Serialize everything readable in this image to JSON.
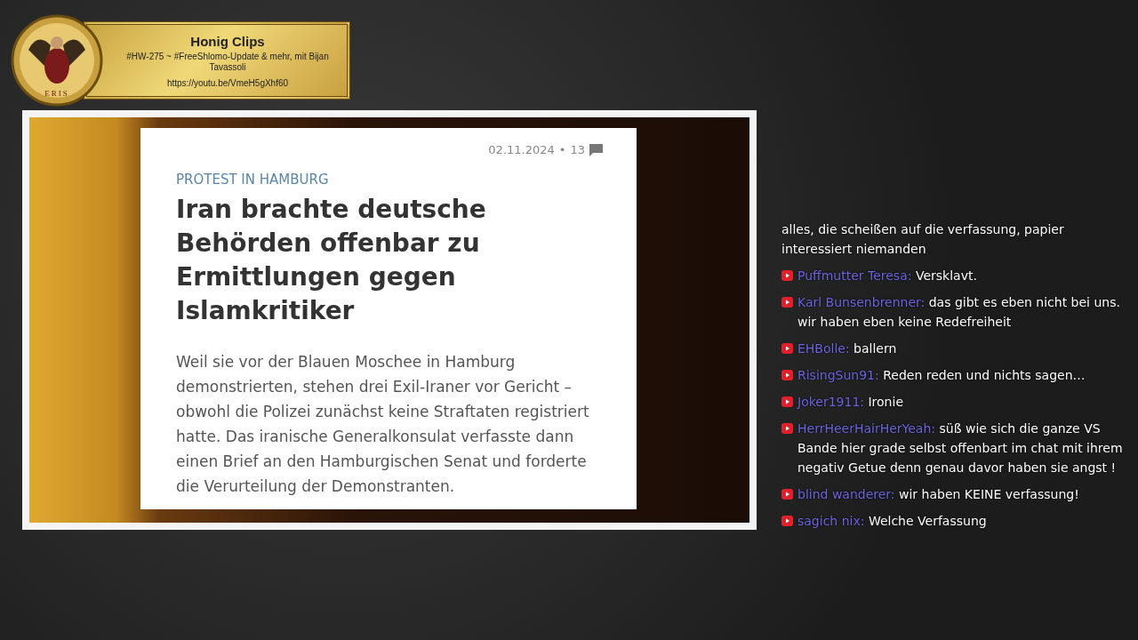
{
  "banner": {
    "title": "Honig Clips",
    "subtitle": "#HW-275 ~ #FreeShlomo-Update & mehr, mit Bijan Tavassoli",
    "url": "https://youtu.be/VmeH5gXhf60",
    "logo_text": "ERIS"
  },
  "article": {
    "date": "02.11.2024",
    "separator": "•",
    "comment_count": "13",
    "kicker": "PROTEST IN HAMBURG",
    "headline": "Iran brachte deutsche Behörden offenbar zu Ermittlungen gegen Islamkritiker",
    "body": "Weil sie vor der Blauen Moschee in Hamburg demonstrierten, stehen drei Exil-Iraner vor Gericht – obwohl die Polizei zunächst keine Straftaten registriert hatte. Das iranische Generalkonsulat verfasste dann einen Brief an den Hamburgischen Senat und forderte die Verurteilung der Demonstranten."
  },
  "chat": {
    "messages": [
      {
        "text": "alles, die scheißen auf die verfassung, papier interessiert niemanden"
      },
      {
        "author": "Puffmutter Teresa:",
        "text": "Versklavt."
      },
      {
        "author": "Karl Bunsenbrenner:",
        "text": "das gibt es eben nicht bei uns. wir haben eben keine Redefreiheit"
      },
      {
        "author": "EHBolle:",
        "text": "ballern"
      },
      {
        "author": "RisingSun91:",
        "text": "Reden reden und nichts sagen…"
      },
      {
        "author": "Joker1911:",
        "text": "Ironie"
      },
      {
        "author": "HerrHeerHairHerYeah:",
        "text": "süß wie sich die ganze VS Bande hier grade selbst offenbart im chat mit ihrem negativ Getue denn genau davor haben sie angst !"
      },
      {
        "author": "blind wanderer:",
        "text": "wir haben KEINE verfassung!"
      },
      {
        "author": "sagich nix:",
        "text": "Welche Verfassung"
      }
    ]
  }
}
